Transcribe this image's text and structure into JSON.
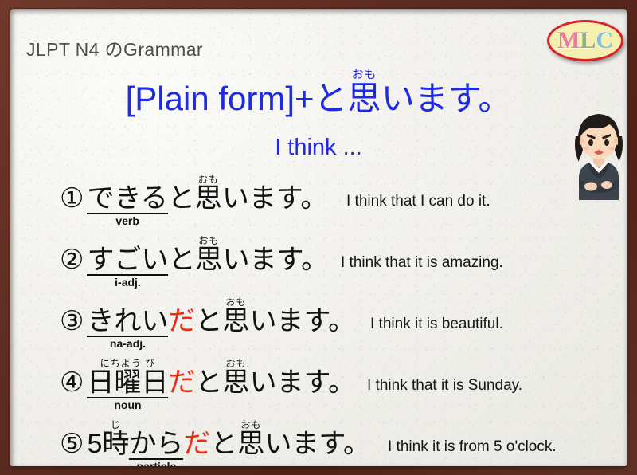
{
  "header": {
    "title": "JLPT N4 のGrammar"
  },
  "logo": {
    "letter1": "M",
    "letter2": "L",
    "letter3": "C",
    "color1": "#e8799f",
    "color2": "#8fae85",
    "color3": "#7fc0dd",
    "fill": "#f6f0b0",
    "border": "#d8232a"
  },
  "title": {
    "pattern_prefix": "[Plain form]+と",
    "kanji": "思",
    "furigana": "おも",
    "pattern_suffix": "います。",
    "subtitle": "I think ...",
    "color": "#1f2ae4"
  },
  "colors": {
    "frame": "#5d2c20",
    "paper": "#f3f2ee",
    "accent_red": "#ee2b10",
    "accent_blue": "#1f2ae4",
    "text": "#111111",
    "header_text": "#4b4b4b"
  },
  "illustration": {
    "name": "thinking-woman-illustration",
    "description": "woman in dark suit with crossed arms frowning"
  },
  "examples": [
    {
      "number": "①",
      "highlight": "できる",
      "tag": "verb",
      "da": "",
      "tail_prefix": "と",
      "kanji": "思",
      "furigana": "おも",
      "tail_suffix": "います。",
      "english": "I think that I can do it."
    },
    {
      "number": "②",
      "highlight": "すごい",
      "tag": "i-adj.",
      "da": "",
      "tail_prefix": "と",
      "kanji": "思",
      "furigana": "おも",
      "tail_suffix": "います。",
      "english": "I think that it is amazing."
    },
    {
      "number": "③",
      "highlight": "きれい",
      "tag": "na-adj.",
      "da": "だ",
      "tail_prefix": "と",
      "kanji": "思",
      "furigana": "おも",
      "tail_suffix": "います。",
      "english": "I think it is beautiful."
    },
    {
      "number": "④",
      "highlight": "日曜日",
      "highlight_furigana": "にちよう び",
      "tag": "noun",
      "da": "だ",
      "tail_prefix": "と",
      "kanji": "思",
      "furigana": "おも",
      "tail_suffix": "います。",
      "english": "I think that it is Sunday."
    },
    {
      "number": "⑤",
      "lead_number": "5",
      "lead_kanji": "時",
      "lead_furigana": "じ",
      "highlight": "から",
      "tag": "particle",
      "da": "だ",
      "tail_prefix": "と",
      "kanji": "思",
      "furigana": "おも",
      "tail_suffix": "います。",
      "english": "I think it is from 5 o'clock."
    }
  ]
}
